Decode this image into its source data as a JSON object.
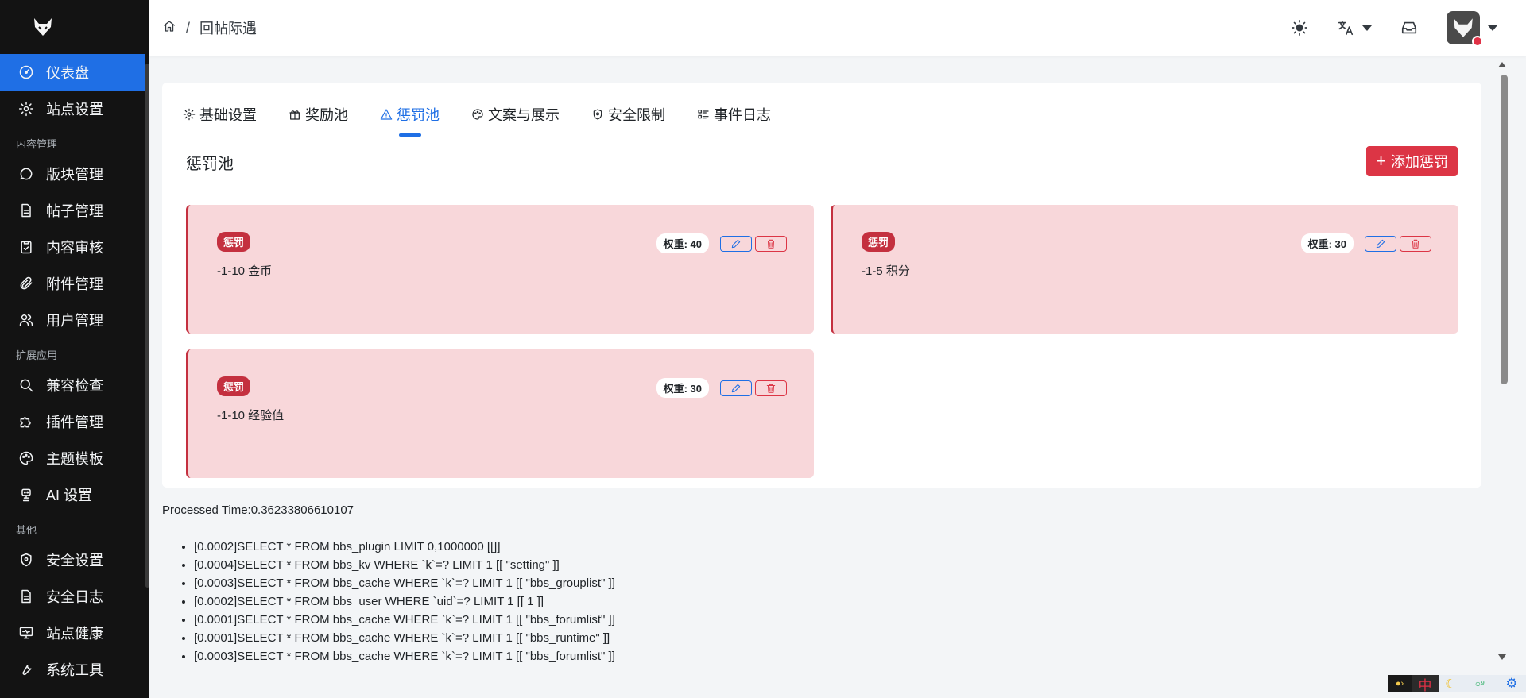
{
  "sidebar": {
    "top_items": [
      {
        "label": "仪表盘",
        "icon": "dashboard-icon"
      },
      {
        "label": "站点设置",
        "icon": "gear-icon"
      }
    ],
    "groups": [
      {
        "title": "内容管理",
        "items": [
          {
            "label": "版块管理",
            "icon": "chat-bubble-icon"
          },
          {
            "label": "帖子管理",
            "icon": "document-icon"
          },
          {
            "label": "内容审核",
            "icon": "clipboard-check-icon"
          },
          {
            "label": "附件管理",
            "icon": "paperclip-icon"
          },
          {
            "label": "用户管理",
            "icon": "users-icon"
          }
        ]
      },
      {
        "title": "扩展应用",
        "items": [
          {
            "label": "兼容检查",
            "icon": "search-icon"
          },
          {
            "label": "插件管理",
            "icon": "puzzle-icon"
          },
          {
            "label": "主题模板",
            "icon": "palette-icon"
          },
          {
            "label": "AI 设置",
            "icon": "robot-icon"
          }
        ]
      },
      {
        "title": "其他",
        "items": [
          {
            "label": "安全设置",
            "icon": "shield-icon"
          },
          {
            "label": "安全日志",
            "icon": "document-icon"
          },
          {
            "label": "站点健康",
            "icon": "monitor-icon"
          },
          {
            "label": "系统工具",
            "icon": "tools-icon"
          }
        ]
      }
    ]
  },
  "header": {
    "breadcrumb_sep": "/",
    "breadcrumb_current": "回帖际遇"
  },
  "tabs": [
    {
      "label": "基础设置",
      "icon": "gear-icon"
    },
    {
      "label": "奖励池",
      "icon": "gift-icon"
    },
    {
      "label": "惩罚池",
      "icon": "warning-icon"
    },
    {
      "label": "文案与展示",
      "icon": "palette-icon"
    },
    {
      "label": "安全限制",
      "icon": "shield-icon"
    },
    {
      "label": "事件日志",
      "icon": "list-icon"
    }
  ],
  "active_tab": "惩罚池",
  "section_title": "惩罚池",
  "add_button": {
    "plus": "+",
    "label": "添加惩罚"
  },
  "penalties": [
    {
      "badge": "惩罚",
      "desc": "-1-10 金币",
      "weight": "权重: 40"
    },
    {
      "badge": "惩罚",
      "desc": "-1-5 积分",
      "weight": "权重: 30"
    },
    {
      "badge": "惩罚",
      "desc": "-1-10 经验值",
      "weight": "权重: 30"
    }
  ],
  "processed_time": "Processed Time:0.36233806610107",
  "queries": [
    "[0.0002]SELECT * FROM bbs_plugin LIMIT 0,1000000 [[]]",
    "[0.0004]SELECT * FROM bbs_kv WHERE `k`=? LIMIT 1 [[ \"setting\" ]]",
    "[0.0003]SELECT * FROM bbs_cache WHERE `k`=? LIMIT 1 [[ \"bbs_grouplist\" ]]",
    "[0.0002]SELECT * FROM bbs_user WHERE `uid`=? LIMIT 1 [[ 1 ]]",
    "[0.0001]SELECT * FROM bbs_cache WHERE `k`=? LIMIT 1 [[ \"bbs_forumlist\" ]]",
    "[0.0001]SELECT * FROM bbs_cache WHERE `k`=? LIMIT 1 [[ \"bbs_runtime\" ]]",
    "[0.0003]SELECT * FROM bbs_cache WHERE `k`=? LIMIT 1 [[ \"bbs_forumlist\" ]]"
  ],
  "ime": {
    "s2": "中",
    "s3": "☾",
    "s4": "○⁹",
    "s5": "⚙"
  },
  "colors": {
    "accent": "#1f6fe5",
    "danger": "#dc3545",
    "penalty_bg": "#f8d7da",
    "sidebar_bg": "#131313"
  }
}
